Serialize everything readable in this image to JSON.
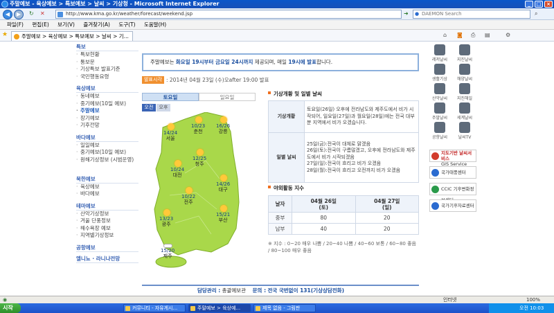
{
  "window": {
    "title": "주말예보 - 육상예보 > 특보예보 > 날씨 > 기상청 - Microsoft Internet Explorer"
  },
  "address": {
    "url": "http://www.kma.go.kr/weather/forecast/weekend.jsp",
    "search_placeholder": "DAEMON Search"
  },
  "menu": [
    "파일(F)",
    "편집(E)",
    "보기(V)",
    "즐겨찾기(A)",
    "도구(T)",
    "도움말(H)"
  ],
  "tab": {
    "label": "주말예보 > 육상예보 > 특보예보 > 날씨 > 기..."
  },
  "page_header": "육상예보 > 주말예보",
  "leftnav": {
    "sections": [
      {
        "title": "특보",
        "items": [
          "특보현황",
          "통보문",
          "기상특보 발표기준",
          "국민행동요령"
        ]
      },
      {
        "title": "육상예보",
        "items": [
          "동네예보",
          "중기예보(10일 예보)",
          "주말예보",
          "장기예보",
          "기후전망"
        ]
      },
      {
        "title": "바다예보",
        "items": [
          "일일예보",
          "중기예보(10일 예보)",
          "원해기상정보 (시범운영)"
        ]
      },
      {
        "title": "북한예보",
        "items": [
          "육상예보",
          "바다예보"
        ]
      },
      {
        "title": "테마예보",
        "items": [
          "산악기상정보",
          "겨울 단풍정보",
          "해수욕장 예보",
          "지역별기상정보"
        ]
      },
      {
        "title": "공항예보",
        "items": []
      },
      {
        "title": "엘니뇨 · 라니냐전망",
        "items": []
      }
    ],
    "active": "주말예보"
  },
  "notice": {
    "text_a": "주말예보는 ",
    "bold_a": "화요일 19시부터 금요일 24시까지",
    "text_b": " 제공되며, 매일 ",
    "bold_b": "19시에 발표",
    "text_c": "합니다."
  },
  "announce": {
    "badge": "발표시각",
    "time": ": 2014년 04월 23일 (수)오after 19:00 발표"
  },
  "tabs": {
    "sat": "토요일",
    "sun": "일요일"
  },
  "ampm": {
    "am": "오전",
    "pm": "오후"
  },
  "cities": [
    {
      "name": "서울",
      "temp": "14/24"
    },
    {
      "name": "춘천",
      "temp": "10/23"
    },
    {
      "name": "강릉",
      "temp": "16/26"
    },
    {
      "name": "청주",
      "temp": "12/25"
    },
    {
      "name": "대전",
      "temp": "10/24"
    },
    {
      "name": "대구",
      "temp": "14/26"
    },
    {
      "name": "전주",
      "temp": "10/22"
    },
    {
      "name": "광주",
      "temp": "13/23"
    },
    {
      "name": "부산",
      "temp": "15/21"
    },
    {
      "name": "제주",
      "temp": "15/20"
    }
  ],
  "wx_section": {
    "title": "기상개황 및 일별 날씨",
    "overview_label": "기상개황",
    "overview_text": "토요일(26일) 오후에 전라남도와 제주도에서 비가 시작되어, 일요일(27일)과 월요일(28일)에는 전국 대부분 지역에서 비가 오겠습니다.",
    "daily_label": "일별 날씨",
    "daily_lines": [
      "25일(금):전국이 대체로 맑겠음",
      "26일(토):전국이 구름많겠고, 오후에 전라남도와 제주도에서 비가 시작되겠음",
      "27일(일):전국이 흐리고 비가 오겠음",
      "28일(월):전국이 흐리고 오전까지 비가 오겠음"
    ]
  },
  "activity": {
    "title": "야외활동 지수",
    "col_region": "날자",
    "col_sat_line1": "04월 26일",
    "col_sat_line2": "(토)",
    "col_sun_line1": "04월 27일",
    "col_sun_line2": "(일)",
    "rows": [
      {
        "region": "중부",
        "sat": "80",
        "sun": "20"
      },
      {
        "region": "남부",
        "sat": "40",
        "sun": "20"
      }
    ],
    "note": "※ 지수 : 0~20 매우 나쁨 / 20~40 나쁨 / 40~60 보통 / 60~80 좋음 / 80~100 매우 좋음"
  },
  "footer": {
    "manager_label": "담당관리 :",
    "manager_value": "총괄예보관",
    "inquiry_label": "문의 :",
    "inquiry_value": "전국 국번없이 131(기상상담전화)"
  },
  "rightbar": {
    "icons": [
      {
        "label": "레저날씨",
        "icon": "leisure-icon"
      },
      {
        "label": "지진날씨",
        "icon": "earthquake-icon"
      },
      {
        "label": "생활기상",
        "icon": "life-icon"
      },
      {
        "label": "해양날씨",
        "icon": "sea-icon"
      },
      {
        "label": "산악날씨",
        "icon": "mountain-icon"
      },
      {
        "label": "지진해일",
        "icon": "tsunami-icon"
      },
      {
        "label": "주말날씨",
        "icon": "weekend-icon"
      },
      {
        "label": "세계날씨",
        "icon": "world-icon"
      },
      {
        "label": "공항날씨",
        "icon": "airport-icon"
      },
      {
        "label": "날씨TV",
        "icon": "tv-icon"
      }
    ],
    "banners": [
      {
        "line1": "지도기반 날씨서비스",
        "line2": "GIS Service"
      },
      {
        "line1": "국가태풍센터",
        "line2": ""
      },
      {
        "line1": "CCIC 기후변화정보센터",
        "line2": ""
      },
      {
        "line1": "국가기후자료센터",
        "line2": ""
      }
    ]
  },
  "status": {
    "left": "",
    "zone": "인터넷",
    "zoom": "100%"
  },
  "taskbar": {
    "start": "시작",
    "buttons": [
      "커뮤니티 - 자유게시...",
      "주말예보 > 육상예...",
      "제목 없음 - 그림판"
    ],
    "clock": "오전 10:03"
  }
}
